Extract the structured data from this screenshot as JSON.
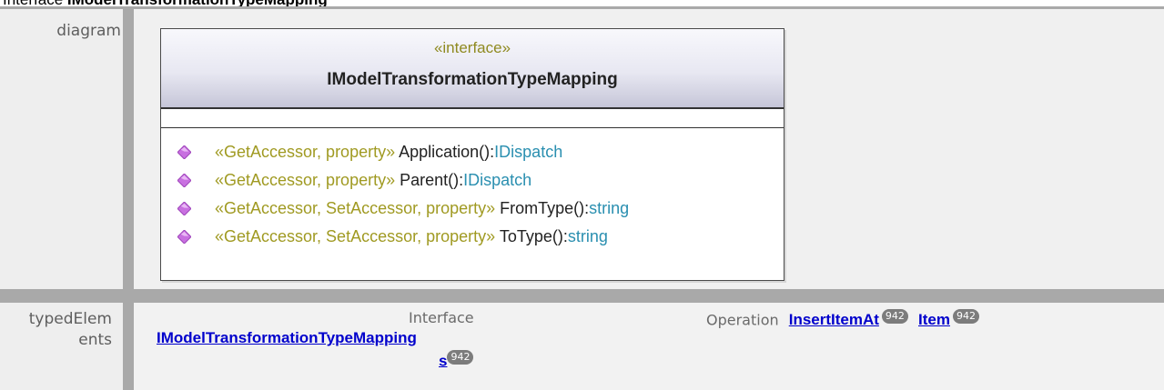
{
  "header": {
    "prefix": "Interface ",
    "name": "IModelTransformationTypeMapping"
  },
  "rows": {
    "diagram_label": "diagram",
    "typed_label_1": "typedElem",
    "typed_label_2": "ents"
  },
  "uml": {
    "stereotype": "«interface»",
    "name": "IModelTransformationTypeMapping",
    "operations": [
      {
        "stereotype": "«GetAccessor, property»",
        "name": " Application():",
        "type": "IDispatch"
      },
      {
        "stereotype": "«GetAccessor, property»",
        "name": " Parent():",
        "type": "IDispatch"
      },
      {
        "stereotype": "«GetAccessor, SetAccessor, property»",
        "name": " FromType():",
        "type": "string"
      },
      {
        "stereotype": "«GetAccessor, SetAccessor, property»",
        "name": " ToType():",
        "type": "string"
      }
    ]
  },
  "typed": {
    "interface_label": "Interface",
    "interface_link_1": "IModelTransformationTypeMapping",
    "interface_link_2": "s",
    "interface_badge": "942",
    "operation_label": "Operation",
    "op_link_1": "InsertItemAt",
    "op_badge_1": "942",
    "op_link_2": "Item",
    "op_badge_2": "942"
  },
  "colors": {
    "stereotype": "#a09a22",
    "type": "#2a8fb0",
    "diamond": "#c870e0",
    "link": "#0000cc"
  }
}
